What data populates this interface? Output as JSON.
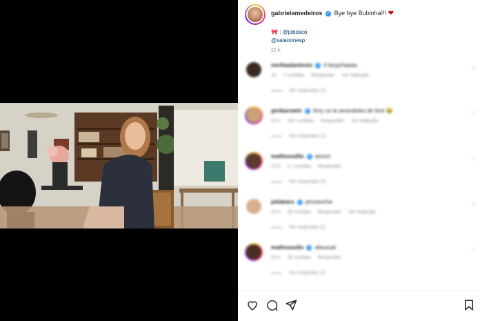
{
  "post": {
    "username": "gabrielamedeiros",
    "caption": "Bye bye Bubinha!!!",
    "credit_hair": ": @jobosco",
    "credit_salon": "@salaoonesp",
    "time": "22 h"
  },
  "comments": [
    {
      "user": "nerifaadantonio",
      "text": "Il tiezprhaaaa",
      "meta": [
        "1h",
        "7 curtidas",
        "Responder",
        "Ver tradução"
      ],
      "replies": "Ver respostas (1)"
    },
    {
      "user": "ginikarowin",
      "text": "Amy ce la serandoles de linst",
      "meta": [
        "22 h",
        "161 curtidas",
        "Responder",
        "Ver tradução"
      ],
      "replies": "Ver respostas (1)"
    },
    {
      "user": "matfeooulllo",
      "text": "amorz",
      "meta": [
        "22 h",
        "17 curtidas",
        "Responder"
      ],
      "replies": "Ver respostas (2)"
    },
    {
      "user": "juliabaru",
      "text": "pirosaoche",
      "meta": [
        "22 h",
        "28 curtidas",
        "Responder",
        "Ver tradução"
      ],
      "replies": "Ver respostas (1)"
    },
    {
      "user": "matheusollo",
      "text": "afausual",
      "meta": [
        "22 h",
        "28 curtidas",
        "Responder"
      ],
      "replies": "Ver respostas (1)"
    }
  ],
  "icons": {
    "like": "heart-outline-icon",
    "comment": "comment-bubble-icon",
    "share": "paper-plane-icon",
    "save": "bookmark-icon"
  },
  "colors": {
    "verified": "#3897f0",
    "heart": "#d0021b",
    "link": "#00376b",
    "muted": "#8e8e8e"
  }
}
